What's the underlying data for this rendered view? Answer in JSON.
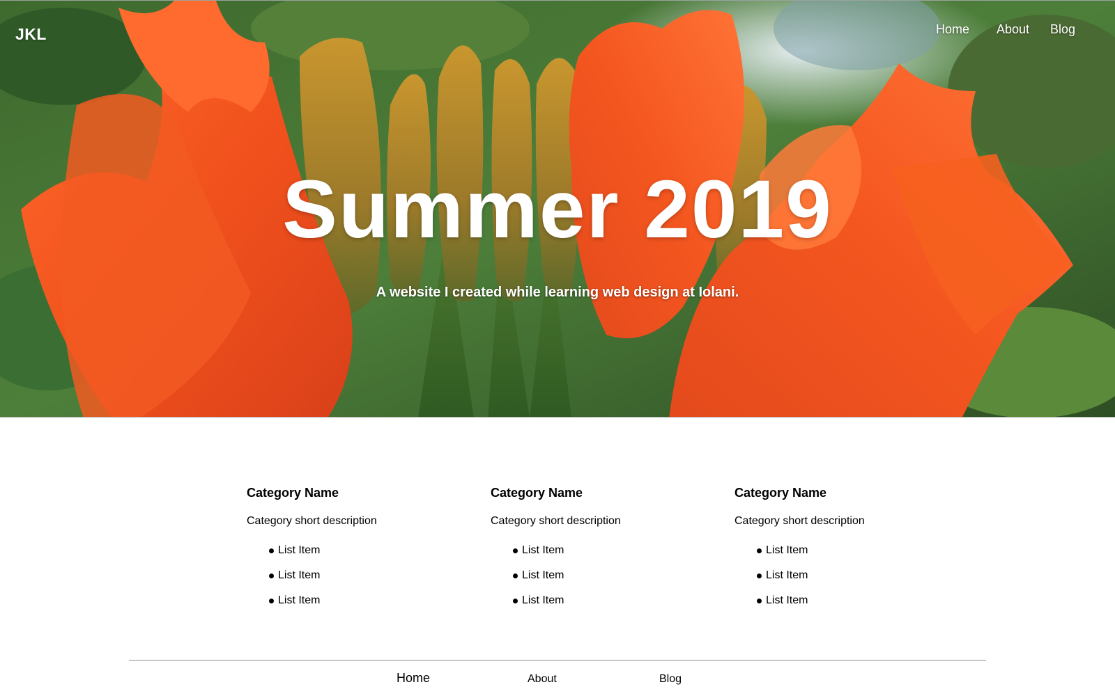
{
  "header": {
    "brand": "JKL",
    "nav": [
      {
        "label": "Home"
      },
      {
        "label": "About"
      },
      {
        "label": "Blog"
      }
    ]
  },
  "hero": {
    "title": "Summer 2019",
    "subtitle": "A website I created while learning web design at Iolani.",
    "background": "orange-flower-photo",
    "colors": {
      "petal": "#f2541f",
      "leaf": "#3d7a3a",
      "bud": "#b58a2c"
    }
  },
  "categories": [
    {
      "title": "Category Name",
      "description": "Category short description",
      "items": [
        "List Item",
        "List Item",
        "List Item"
      ]
    },
    {
      "title": "Category Name",
      "description": "Category short description",
      "items": [
        "List Item",
        "List Item",
        "List Item"
      ]
    },
    {
      "title": "Category Name",
      "description": "Category short description",
      "items": [
        "List Item",
        "List Item",
        "List Item"
      ]
    }
  ],
  "footer": {
    "nav": [
      {
        "label": "Home"
      },
      {
        "label": "About"
      },
      {
        "label": "Blog"
      }
    ]
  }
}
